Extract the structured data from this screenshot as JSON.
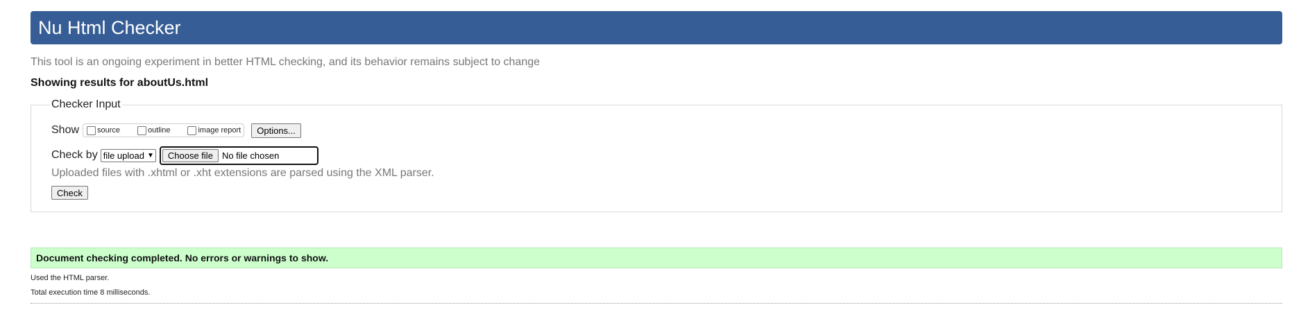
{
  "header": {
    "title": "Nu Html Checker"
  },
  "tagline": "This tool is an ongoing experiment in better HTML checking, and its behavior remains subject to change",
  "results_for": "Showing results for aboutUs.html",
  "checker_input": {
    "legend": "Checker Input",
    "show_label": "Show",
    "show_options": [
      {
        "label": "source",
        "checked": false
      },
      {
        "label": "outline",
        "checked": false
      },
      {
        "label": "image report",
        "checked": false
      }
    ],
    "options_button": "Options...",
    "check_by_label": "Check by",
    "check_by_selected": "file upload",
    "choose_file_button": "Choose file",
    "file_status": "No file chosen",
    "hint": "Uploaded files with .xhtml or .xht extensions are parsed using the XML parser.",
    "check_button": "Check"
  },
  "result": {
    "message": "Document checking completed. No errors or warnings to show.",
    "color": "#ccffcc"
  },
  "meta": {
    "parser": "Used the HTML parser.",
    "execution_time": "Total execution time 8 milliseconds."
  },
  "colors": {
    "header_bg": "#365d95",
    "muted_text": "#777777"
  }
}
